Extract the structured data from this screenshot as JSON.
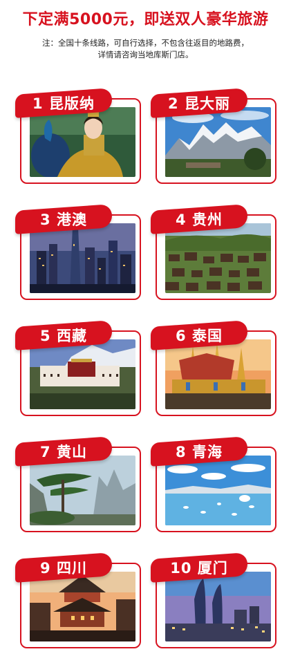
{
  "headline": "下定满5000元，即送双人豪华旅游",
  "note": {
    "line1": "注：全国十条线路，可自行选择，不包含往返目的地路费，",
    "line2": "详情请咨询当地库斯门店。"
  },
  "colors": {
    "accent": "#d7121f",
    "text": "#222222",
    "background": "#ffffff"
  },
  "destinations": [
    {
      "label": "1 昆版纳",
      "photo": "woman-peacock-costume"
    },
    {
      "label": "2 昆大丽",
      "photo": "snow-mountain-village"
    },
    {
      "label": "3 港澳",
      "photo": "city-skyline-night"
    },
    {
      "label": "4 贵州",
      "photo": "miao-village-hillside"
    },
    {
      "label": "5 西藏",
      "photo": "potala-palace"
    },
    {
      "label": "6 泰国",
      "photo": "grand-palace-temple"
    },
    {
      "label": "7 黄山",
      "photo": "huangshan-pine-peaks"
    },
    {
      "label": "8 青海",
      "photo": "qinghai-lake-birds"
    },
    {
      "label": "9 四川",
      "photo": "ancient-town-tower"
    },
    {
      "label": "10 厦门",
      "photo": "xiamen-twin-towers"
    }
  ]
}
